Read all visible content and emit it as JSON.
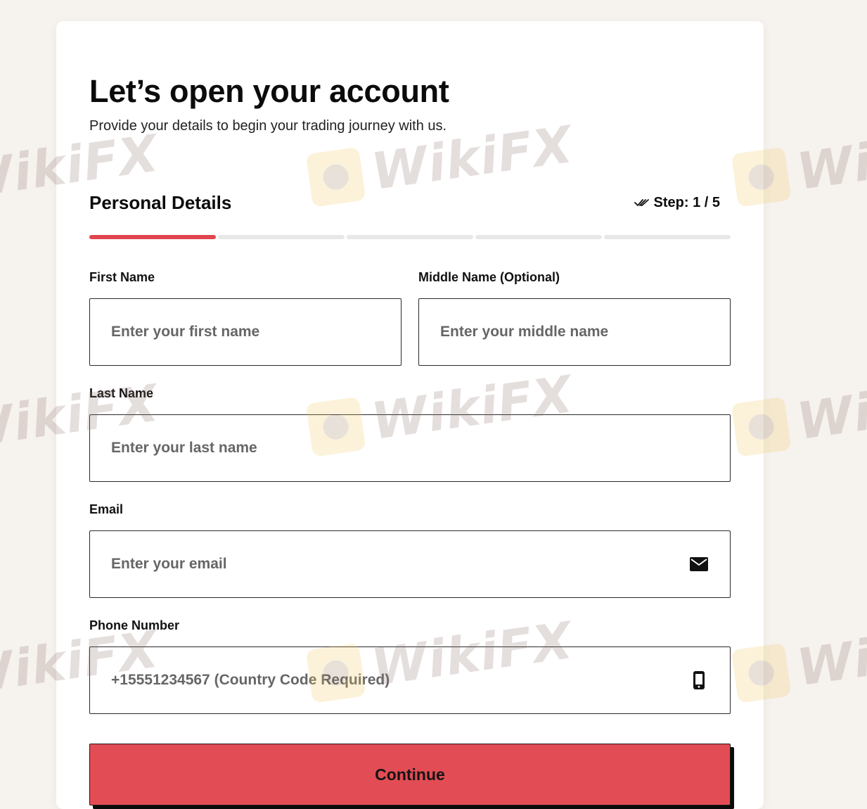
{
  "header": {
    "title": "Let’s open your account",
    "subtitle": "Provide your details to begin your trading journey with us."
  },
  "section": {
    "title": "Personal Details",
    "step_label": "Step: 1 / 5",
    "step_icon": "double-check-icon",
    "steps_total": 5,
    "steps_completed": 1
  },
  "form": {
    "first_name": {
      "label": "First Name",
      "placeholder": "Enter your first name"
    },
    "middle_name": {
      "label": "Middle Name (Optional)",
      "placeholder": "Enter your middle name"
    },
    "last_name": {
      "label": "Last Name",
      "placeholder": "Enter your last name"
    },
    "email": {
      "label": "Email",
      "placeholder": "Enter your email",
      "icon": "envelope-icon"
    },
    "phone": {
      "label": "Phone Number",
      "placeholder": "+15551234567 (Country Code Required)",
      "icon": "mobile-phone-icon"
    },
    "submit_label": "Continue"
  },
  "watermark": {
    "text": "WikiFX"
  },
  "colors": {
    "accent": "#e24d55",
    "progress_active": "#e0464f",
    "progress_inactive": "#e8e8e8",
    "page_background": "#f6f2ee",
    "card_background": "#ffffff",
    "border": "#2a2a2a"
  }
}
